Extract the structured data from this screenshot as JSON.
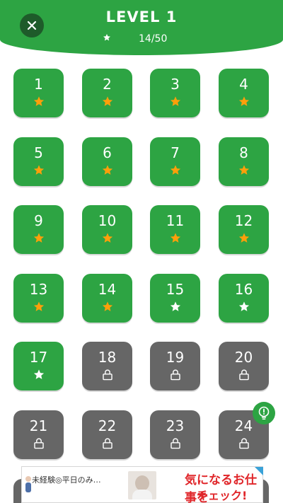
{
  "header": {
    "title": "LEVEL 1",
    "progress": "14/50",
    "close_icon": "close-icon",
    "star_icon": "star-icon"
  },
  "colors": {
    "green": "#2da443",
    "dark_green": "#1e5b2a",
    "locked_gray": "#666666",
    "star_orange": "#ff9f0a",
    "star_white": "#ffffff"
  },
  "levels": [
    {
      "n": "1",
      "state": "starred"
    },
    {
      "n": "2",
      "state": "starred"
    },
    {
      "n": "3",
      "state": "starred"
    },
    {
      "n": "4",
      "state": "starred"
    },
    {
      "n": "5",
      "state": "starred"
    },
    {
      "n": "6",
      "state": "starred"
    },
    {
      "n": "7",
      "state": "starred"
    },
    {
      "n": "8",
      "state": "starred"
    },
    {
      "n": "9",
      "state": "starred"
    },
    {
      "n": "10",
      "state": "starred"
    },
    {
      "n": "11",
      "state": "starred"
    },
    {
      "n": "12",
      "state": "starred"
    },
    {
      "n": "13",
      "state": "starred"
    },
    {
      "n": "14",
      "state": "starred"
    },
    {
      "n": "15",
      "state": "open"
    },
    {
      "n": "16",
      "state": "open"
    },
    {
      "n": "17",
      "state": "open"
    },
    {
      "n": "18",
      "state": "locked"
    },
    {
      "n": "19",
      "state": "locked"
    },
    {
      "n": "20",
      "state": "locked"
    },
    {
      "n": "21",
      "state": "locked"
    },
    {
      "n": "22",
      "state": "locked"
    },
    {
      "n": "23",
      "state": "locked"
    },
    {
      "n": "24",
      "state": "locked"
    }
  ],
  "hint_icon": "lightbulb-icon",
  "ad": {
    "left_text": "未経験◎平日のみ…",
    "right_line1": "気になるお仕事を",
    "right_line2": "チェック!",
    "info_icon": "info-icon"
  }
}
